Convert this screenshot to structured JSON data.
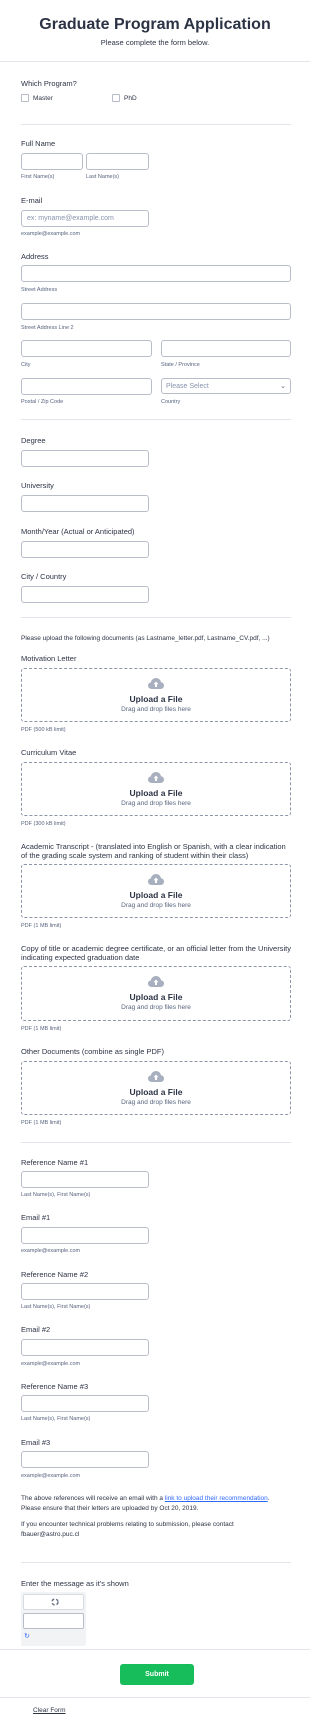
{
  "header": {
    "title": "Graduate Program Application",
    "subtitle": "Please complete the form below."
  },
  "program": {
    "label": "Which Program?",
    "options": [
      "Master",
      "PhD"
    ]
  },
  "full_name": {
    "label": "Full Name",
    "first_sub": "First Name(s)",
    "last_sub": "Last Name(s)"
  },
  "email": {
    "label": "E-mail",
    "placeholder": "ex: myname@example.com",
    "sub": "example@example.com"
  },
  "address": {
    "label": "Address",
    "street_sub": "Street Address",
    "street2_sub": "Street Address Line 2",
    "city_sub": "City",
    "state_sub": "State / Province",
    "postal_sub": "Postal / Zip Code",
    "country_sub": "Country",
    "country_placeholder": "Please Select"
  },
  "degree": {
    "label": "Degree"
  },
  "university": {
    "label": "University"
  },
  "month_year": {
    "label": "Month/Year (Actual or Anticipated)"
  },
  "city_country": {
    "label": "City / Country"
  },
  "upload_intro": "Please upload the following documents (as Lastname_letter.pdf, Lastname_CV.pdf, ...)",
  "uploads": [
    {
      "label": "Motivation Letter",
      "title": "Upload a File",
      "desc": "Drag and drop files here",
      "sub": "PDF (500 kB limit)"
    },
    {
      "label": "Curriculum Vitae",
      "title": "Upload a File",
      "desc": "Drag and drop files here",
      "sub": "PDF (300 kB limit)"
    },
    {
      "label": "Academic Transcript - (translated into English or Spanish, with a clear indication of the grading scale system and ranking of student within their class)",
      "title": "Upload a File",
      "desc": "Drag and drop files here",
      "sub": "PDF (1 MB limit)"
    },
    {
      "label": "Copy of title or academic degree certificate, or an official letter from the University indicating expected graduation date",
      "title": "Upload a File",
      "desc": "Drag and drop files here",
      "sub": "PDF (1 MB limit)"
    },
    {
      "label": "Other Documents (combine as single PDF)",
      "title": "Upload a File",
      "desc": "Drag and drop files here",
      "sub": "PDF (1 MB limit)"
    }
  ],
  "references": [
    {
      "name_label": "Reference Name #1",
      "name_sub": "Last Name(s), First Name(s)",
      "email_label": "Email #1",
      "email_sub": "example@example.com"
    },
    {
      "name_label": "Reference Name #2",
      "name_sub": "Last Name(s), First Name(s)",
      "email_label": "Email #2",
      "email_sub": "example@example.com"
    },
    {
      "name_label": "Reference Name #3",
      "name_sub": "Last Name(s), First Name(s)",
      "email_label": "Email #3",
      "email_sub": "example@example.com"
    }
  ],
  "notice": {
    "line1_pre": "The above references will receive an email with a ",
    "line1_link": "link to upload their recommendation",
    "line1_post": ".",
    "line2": "Please ensure that their letters are uploaded by Oct 20, 2019.",
    "line3": "If you encounter technical problems relating to submission, please contact fbauer@astro.puc.cl"
  },
  "captcha": {
    "label": "Enter the message as it's shown"
  },
  "actions": {
    "submit": "Submit",
    "clear": "Clear Form"
  },
  "colors": {
    "submit_bg": "#18bd5b",
    "link": "#2e69ff",
    "text": "#2c3345"
  }
}
